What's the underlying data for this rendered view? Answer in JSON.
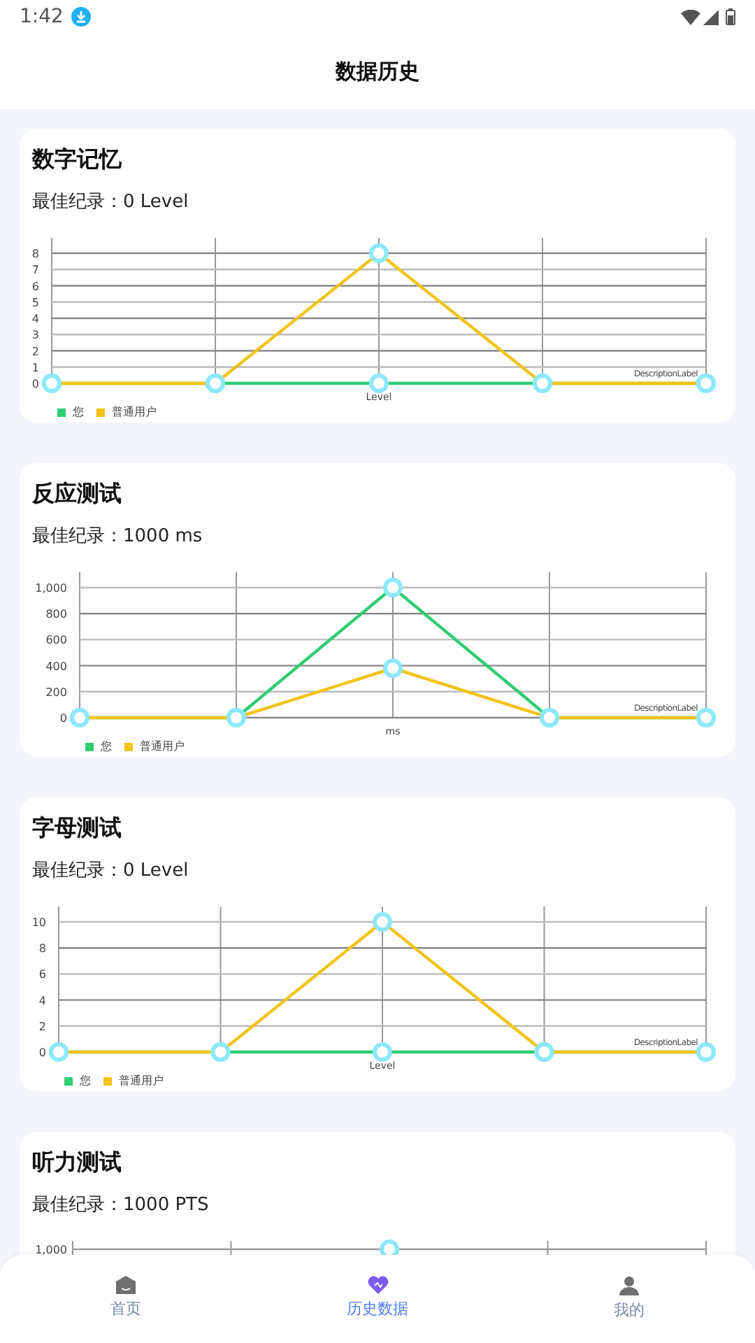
{
  "status_bar": {
    "time": "1:42"
  },
  "header": {
    "title": "数据历史"
  },
  "cards": [
    {
      "title": "数字记忆",
      "best": "最佳纪录：0 Level",
      "chart_data": {
        "type": "line",
        "grid": true,
        "xlabel": "Level",
        "ylim": [
          0,
          8
        ],
        "yticks": [
          0,
          1,
          2,
          3,
          4,
          5,
          6,
          7,
          8
        ],
        "annotations": [
          "DescriptionLabel"
        ],
        "series": [
          {
            "name": "您",
            "color": "#2ecc71",
            "marker": "circle",
            "values": [
              0,
              0,
              0,
              0,
              0
            ]
          },
          {
            "name": "普通用户",
            "color": "#f2c318",
            "marker": "circle",
            "values": [
              0,
              0,
              8,
              0,
              0
            ]
          }
        ]
      }
    },
    {
      "title": "反应测试",
      "best": "最佳纪录：1000 ms",
      "chart_data": {
        "type": "line",
        "grid": true,
        "xlabel": "ms",
        "ylim": [
          0,
          1000
        ],
        "yticks": [
          0,
          200,
          400,
          600,
          800,
          {
            "value": 1000,
            "label": "1,000"
          }
        ],
        "annotations": [
          "DescriptionLabel"
        ],
        "series": [
          {
            "name": "您",
            "color": "#2ecc71",
            "marker": "circle",
            "values": [
              0,
              0,
              1000,
              0,
              0
            ]
          },
          {
            "name": "普通用户",
            "color": "#f2c318",
            "marker": "circle",
            "values": [
              0,
              0,
              380,
              0,
              0
            ]
          }
        ]
      }
    },
    {
      "title": "字母测试",
      "best": "最佳纪录：0 Level",
      "chart_data": {
        "type": "line",
        "grid": true,
        "xlabel": "Level",
        "ylim": [
          0,
          10
        ],
        "yticks": [
          0,
          2,
          4,
          6,
          8,
          10
        ],
        "annotations": [
          "DescriptionLabel"
        ],
        "series": [
          {
            "name": "您",
            "color": "#2ecc71",
            "marker": "circle",
            "values": [
              0,
              0,
              0,
              0,
              0
            ]
          },
          {
            "name": "普通用户",
            "color": "#f2c318",
            "marker": "circle",
            "values": [
              0,
              0,
              10,
              0,
              0
            ]
          }
        ]
      }
    },
    {
      "title": "听力测试",
      "best": "最佳纪录：1000 PTS",
      "chart_stub": {
        "tick_label": "1,000"
      }
    }
  ],
  "tabs": [
    {
      "label": "首页",
      "selected": false
    },
    {
      "label": "历史数据",
      "selected": true
    },
    {
      "label": "我的",
      "selected": false
    }
  ]
}
